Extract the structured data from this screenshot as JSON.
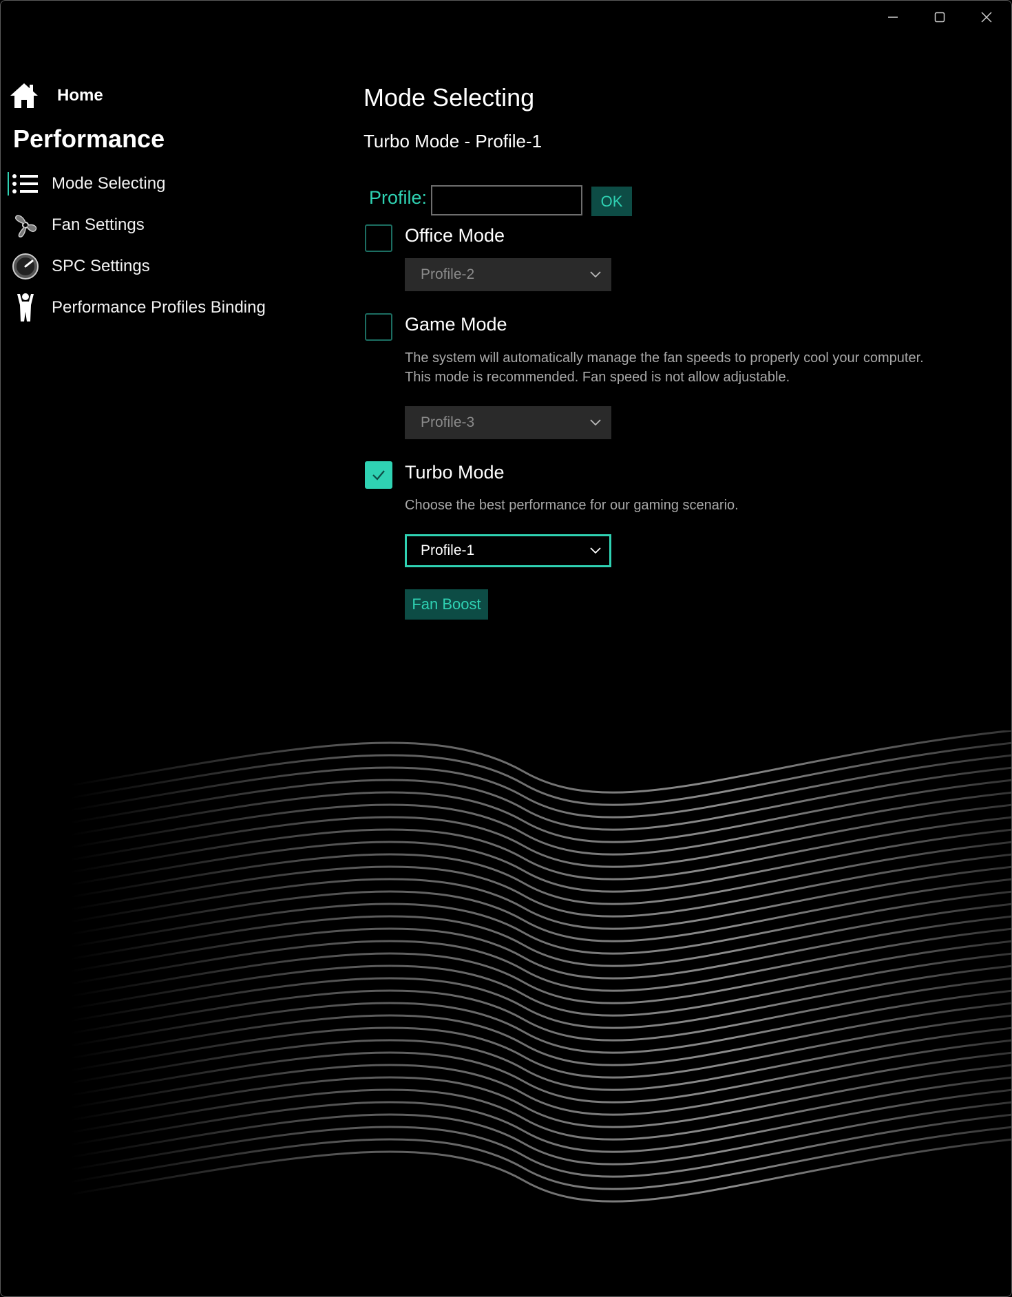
{
  "window": {
    "controls": [
      "minimize",
      "maximize",
      "close"
    ]
  },
  "sidebar": {
    "home_label": "Home",
    "section_title": "Performance",
    "items": [
      {
        "label": "Mode Selecting",
        "icon": "list-icon",
        "active": true
      },
      {
        "label": "Fan Settings",
        "icon": "fan-icon",
        "active": false
      },
      {
        "label": "SPC Settings",
        "icon": "gauge-icon",
        "active": false
      },
      {
        "label": "Performance Profiles Binding",
        "icon": "person-icon",
        "active": false
      }
    ]
  },
  "main": {
    "title": "Mode Selecting",
    "subtitle": "Turbo Mode - Profile-1",
    "profile_label": "Profile:",
    "profile_input_value": "",
    "ok_label": "OK",
    "modes": [
      {
        "label": "Office Mode",
        "checked": false,
        "description": "",
        "profile": "Profile-2"
      },
      {
        "label": "Game Mode",
        "checked": false,
        "description_line1": "The system will automatically manage the fan speeds to properly cool your computer.",
        "description_line2": "This mode is recommended. Fan speed is not allow adjustable.",
        "profile": "Profile-3"
      },
      {
        "label": "Turbo Mode",
        "checked": true,
        "description": "Choose the best performance for our gaming scenario.",
        "profile": "Profile-1"
      }
    ],
    "fan_boost_label": "Fan Boost"
  },
  "colors": {
    "accent": "#2fd2b3",
    "accent_dark": "#0d4c45",
    "background": "#000000"
  }
}
